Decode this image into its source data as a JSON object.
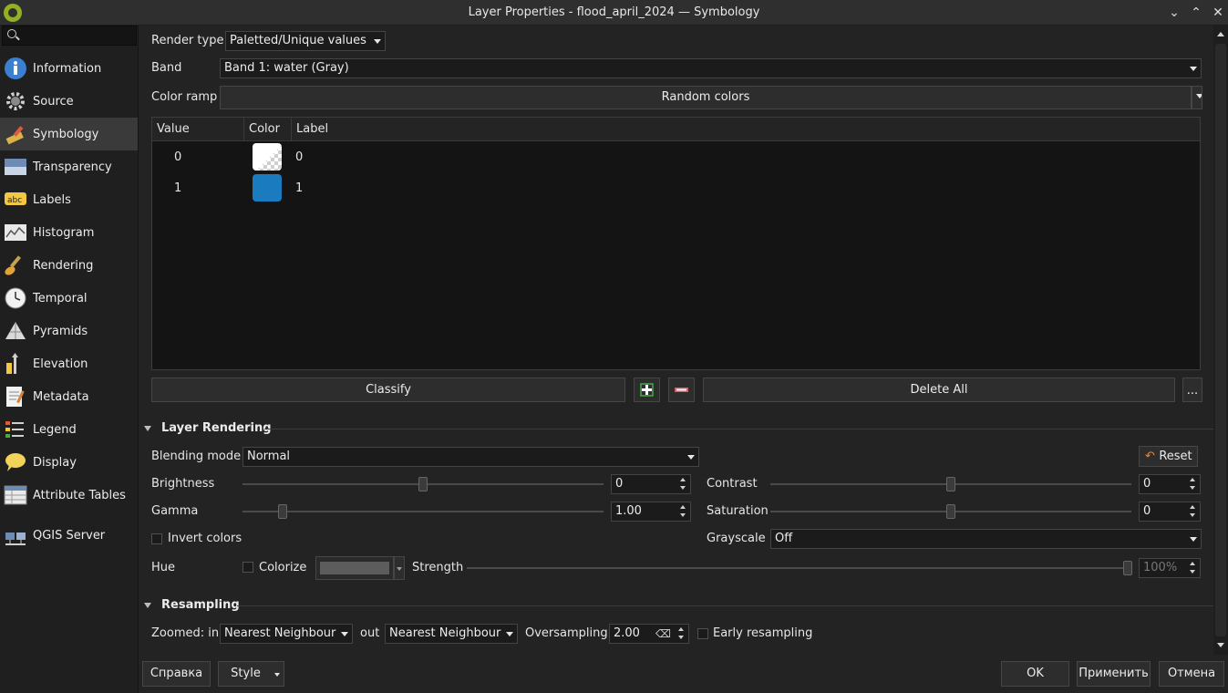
{
  "window": {
    "title": "Layer Properties - flood_april_2024 — Symbology"
  },
  "sidebar": {
    "search_placeholder": "",
    "items": [
      {
        "label": "Information"
      },
      {
        "label": "Source"
      },
      {
        "label": "Symbology"
      },
      {
        "label": "Transparency"
      },
      {
        "label": "Labels"
      },
      {
        "label": "Histogram"
      },
      {
        "label": "Rendering"
      },
      {
        "label": "Temporal"
      },
      {
        "label": "Pyramids"
      },
      {
        "label": "Elevation"
      },
      {
        "label": "Metadata"
      },
      {
        "label": "Legend"
      },
      {
        "label": "Display"
      },
      {
        "label": "Attribute Tables"
      },
      {
        "label": "QGIS Server"
      }
    ],
    "active_index": 2
  },
  "symbology": {
    "render_type_label": "Render type",
    "render_type_value": "Paletted/Unique values",
    "band_label": "Band",
    "band_value": "Band 1: water (Gray)",
    "color_ramp_label": "Color ramp",
    "color_ramp_value": "Random colors",
    "table": {
      "headers": [
        "Value",
        "Color",
        "Label"
      ],
      "rows": [
        {
          "value": "0",
          "color": "#ffffff",
          "label": "0"
        },
        {
          "value": "1",
          "color": "#1a7bbf",
          "label": "1"
        }
      ]
    },
    "classify_label": "Classify",
    "delete_all_label": "Delete All",
    "more_label": "..."
  },
  "layer_rendering": {
    "title": "Layer Rendering",
    "blending_mode_label": "Blending mode",
    "blending_mode_value": "Normal",
    "reset_label": "Reset",
    "brightness_label": "Brightness",
    "brightness_value": "0",
    "brightness_level": 0.5,
    "contrast_label": "Contrast",
    "contrast_value": "0",
    "contrast_level": 0.5,
    "gamma_label": "Gamma",
    "gamma_value": "1.00",
    "gamma_level": 0.1,
    "saturation_label": "Saturation",
    "saturation_value": "0",
    "saturation_level": 0.5,
    "invert_colors_label": "Invert colors",
    "grayscale_label": "Grayscale",
    "grayscale_value": "Off",
    "hue_label": "Hue",
    "colorize_label": "Colorize",
    "colorize_color": "#5c5c5c",
    "strength_label": "Strength",
    "strength_value": "100%",
    "strength_level": 1.0
  },
  "resampling": {
    "title": "Resampling",
    "zoomed_in_label": "Zoomed: in",
    "zoomed_in_value": "Nearest Neighbour",
    "out_label": "out",
    "zoomed_out_value": "Nearest Neighbour",
    "oversampling_label": "Oversampling",
    "oversampling_value": "2.00",
    "early_resampling_label": "Early resampling"
  },
  "footer": {
    "help_label": "Справка",
    "style_label": "Style",
    "ok_label": "OK",
    "apply_label": "Применить",
    "cancel_label": "Отмена"
  },
  "colors": {
    "accent_blue": "#1a7bbf",
    "qgis_green": "#93b023"
  }
}
